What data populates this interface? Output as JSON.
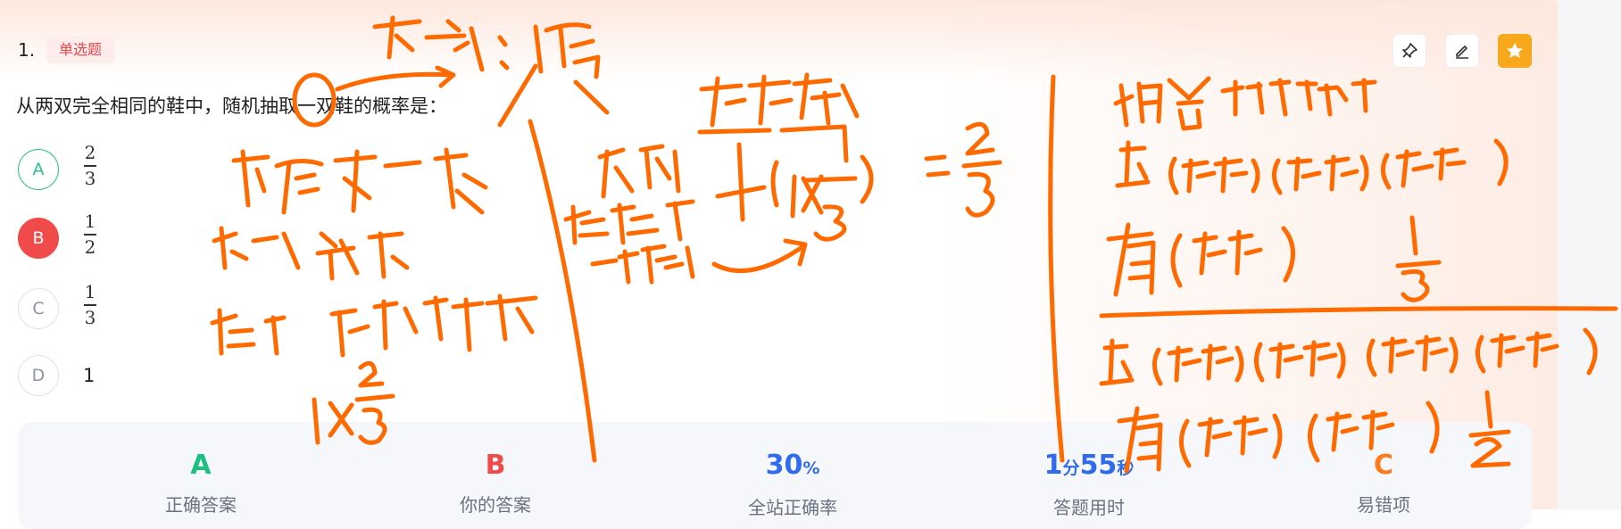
{
  "question": {
    "number": "1.",
    "type": "单选题",
    "stem": "从两双完全相同的鞋中，随机抽取一双鞋的概率是：",
    "options": [
      {
        "letter": "A",
        "num": "2",
        "den": "3",
        "state": "correct"
      },
      {
        "letter": "B",
        "num": "1",
        "den": "2",
        "state": "chosen-wrong"
      },
      {
        "letter": "C",
        "num": "1",
        "den": "3",
        "state": "normal"
      },
      {
        "letter": "D",
        "text": "1",
        "state": "normal"
      }
    ]
  },
  "toolbar": {
    "icons": [
      "pin-icon",
      "edit-icon",
      "star-icon"
    ]
  },
  "stats": {
    "correct_answer": {
      "value": "A",
      "label": "正确答案",
      "color": "#1fbf84"
    },
    "your_answer": {
      "value": "B",
      "label": "你的答案",
      "color": "#f04a4a"
    },
    "site_accuracy": {
      "value": "30",
      "unit": "%",
      "label": "全站正确率",
      "color": "#2f6bea"
    },
    "time_used": {
      "min": "1",
      "min_unit": "分",
      "sec": "55",
      "sec_unit": "秒",
      "label": "答题用时",
      "color": "#2f6bea"
    },
    "common_mistake": {
      "value": "C",
      "label": "易错项",
      "color": "#ff7a1a"
    }
  },
  "colors": {
    "ink": "#ff6a00"
  }
}
